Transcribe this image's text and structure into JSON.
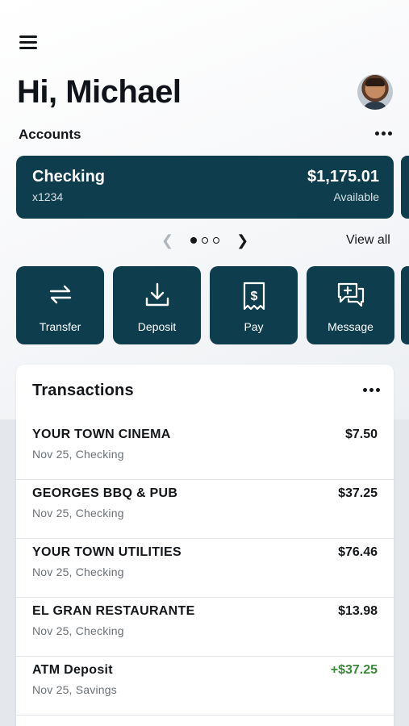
{
  "greeting": "Hi, Michael",
  "accounts": {
    "label": "Accounts",
    "card": {
      "name": "Checking",
      "number": "x1234",
      "balance": "$1,175.01",
      "balance_label": "Available"
    },
    "pager": {
      "total_pages": 3,
      "active_page": 1
    },
    "view_all_label": "View all"
  },
  "actions": [
    {
      "label": "Transfer",
      "icon": "transfer-icon"
    },
    {
      "label": "Deposit",
      "icon": "deposit-icon"
    },
    {
      "label": "Pay",
      "icon": "pay-bill-icon"
    },
    {
      "label": "Message",
      "icon": "message-icon"
    }
  ],
  "transactions": {
    "title": "Transactions",
    "items": [
      {
        "merchant": "YOUR TOWN CINEMA",
        "meta": "Nov 25, Checking",
        "amount": "$7.50",
        "type": "debit"
      },
      {
        "merchant": "GEORGES BBQ & PUB",
        "meta": "Nov 25, Checking",
        "amount": "$37.25",
        "type": "debit"
      },
      {
        "merchant": "YOUR TOWN UTILITIES",
        "meta": "Nov 25, Checking",
        "amount": "$76.46",
        "type": "debit"
      },
      {
        "merchant": "EL GRAN RESTAURANTE",
        "meta": "Nov 25, Checking",
        "amount": "$13.98",
        "type": "debit"
      },
      {
        "merchant": "ATM Deposit",
        "meta": "Nov 25, Savings",
        "amount": "+$37.25",
        "type": "credit"
      }
    ]
  },
  "colors": {
    "primary": "#0e3d4d",
    "credit": "#3a8a3a",
    "text": "#14171a",
    "muted": "#6b7177"
  }
}
